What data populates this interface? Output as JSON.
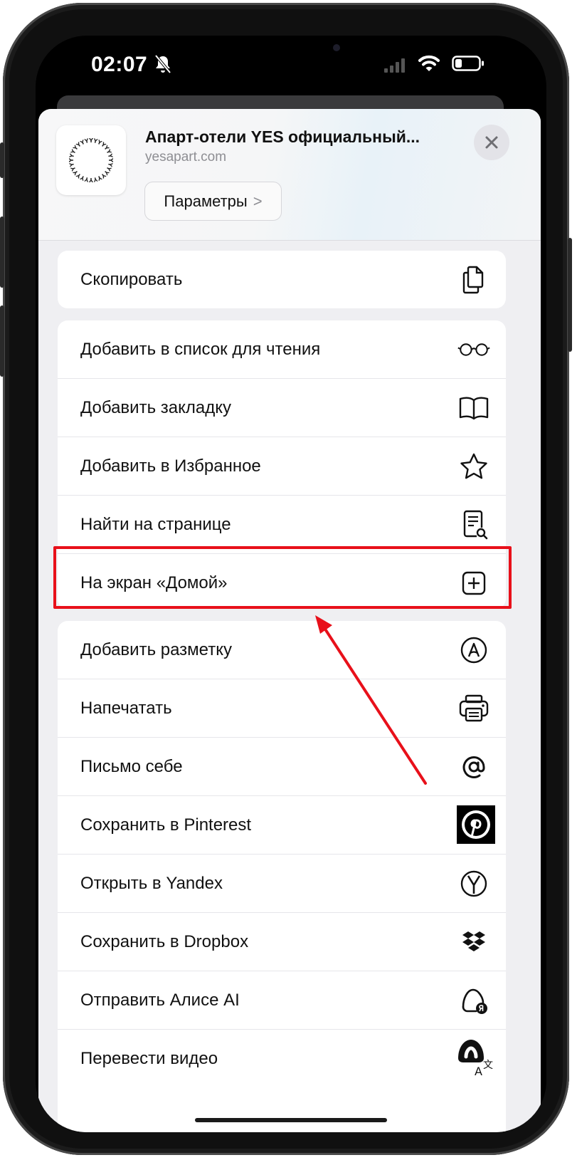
{
  "status_bar": {
    "time": "02:07"
  },
  "site": {
    "title": "Апарт-отели YES официальный...",
    "url": "yesapart.com",
    "params_label": "Параметры",
    "params_chevron": ">"
  },
  "group_copy": [
    {
      "label": "Скопировать",
      "icon": "copy-icon"
    }
  ],
  "group_main": [
    {
      "label": "Добавить в список для чтения",
      "icon": "glasses-icon"
    },
    {
      "label": "Добавить закладку",
      "icon": "book-icon"
    },
    {
      "label": "Добавить в Избранное",
      "icon": "star-icon"
    },
    {
      "label": "Найти на странице",
      "icon": "find-in-page-icon"
    },
    {
      "label": "На экран «Домой»",
      "icon": "add-square-icon"
    }
  ],
  "group_more": [
    {
      "label": "Добавить разметку",
      "icon": "markup-icon"
    },
    {
      "label": "Напечатать",
      "icon": "printer-icon"
    },
    {
      "label": "Письмо себе",
      "icon": "at-icon"
    },
    {
      "label": "Сохранить в Pinterest",
      "icon": "pinterest-icon"
    },
    {
      "label": "Открыть в Yandex",
      "icon": "yandex-icon"
    },
    {
      "label": "Сохранить в Dropbox",
      "icon": "dropbox-icon"
    },
    {
      "label": "Отправить Алисе AI",
      "icon": "alice-icon"
    },
    {
      "label": "Перевести видео",
      "icon": "translate-video-icon"
    }
  ],
  "colors": {
    "highlight": "#e8101a",
    "sheet_bg": "#efeff2",
    "text": "#111111",
    "secondary": "#8e8e93"
  }
}
